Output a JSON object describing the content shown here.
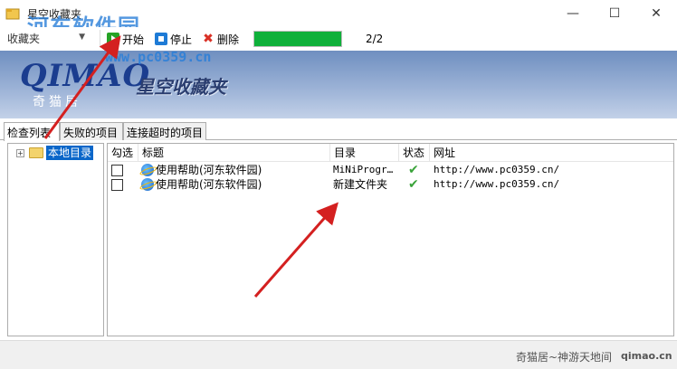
{
  "window": {
    "title": "星空收藏夹",
    "watermark": "河东软件园",
    "minimize_glyph": "—",
    "maximize_glyph": "☐",
    "close_glyph": "✕"
  },
  "toolbar": {
    "dropdown_value": "收藏夹",
    "start_label": "开始",
    "stop_label": "停止",
    "delete_label": "删除",
    "progress_fraction": 1.0,
    "progress_count": "2/2",
    "progress_color": "#0fb03a"
  },
  "banner": {
    "logo": "QIMAO",
    "logo_cn": "奇猫居",
    "title": "星空收藏夹",
    "watermark_url": "www.pc0359.cn"
  },
  "tabs": [
    {
      "label": "检查列表",
      "active": true
    },
    {
      "label": "失败的项目",
      "active": false
    },
    {
      "label": "连接超时的项目",
      "active": false
    }
  ],
  "tree": {
    "expand_glyph": "+",
    "root_label": "本地目录"
  },
  "list": {
    "columns": [
      "勾选",
      "标题",
      "目录",
      "状态",
      "网址"
    ],
    "rows": [
      {
        "checked": false,
        "title": "使用帮助(河东软件园)",
        "directory": "MiNiProgr…",
        "status": "ok",
        "url": "http://www.pc0359.cn/"
      },
      {
        "checked": false,
        "title": "使用帮助(河东软件园)",
        "directory": "新建文件夹",
        "status": "ok",
        "url": "http://www.pc0359.cn/"
      }
    ]
  },
  "statusbar": {
    "text": "奇猫居~神游天地间",
    "domain": "qimao.cn"
  },
  "icons": {
    "app": "favorites-star-icon",
    "start": "play-icon",
    "stop": "stop-icon",
    "delete": "delete-x-icon",
    "folder": "folder-icon",
    "link": "ie-browser-icon",
    "status_ok": "check-icon"
  },
  "colors": {
    "accent": "#0a66c9",
    "annotation_arrow": "#d42020"
  }
}
